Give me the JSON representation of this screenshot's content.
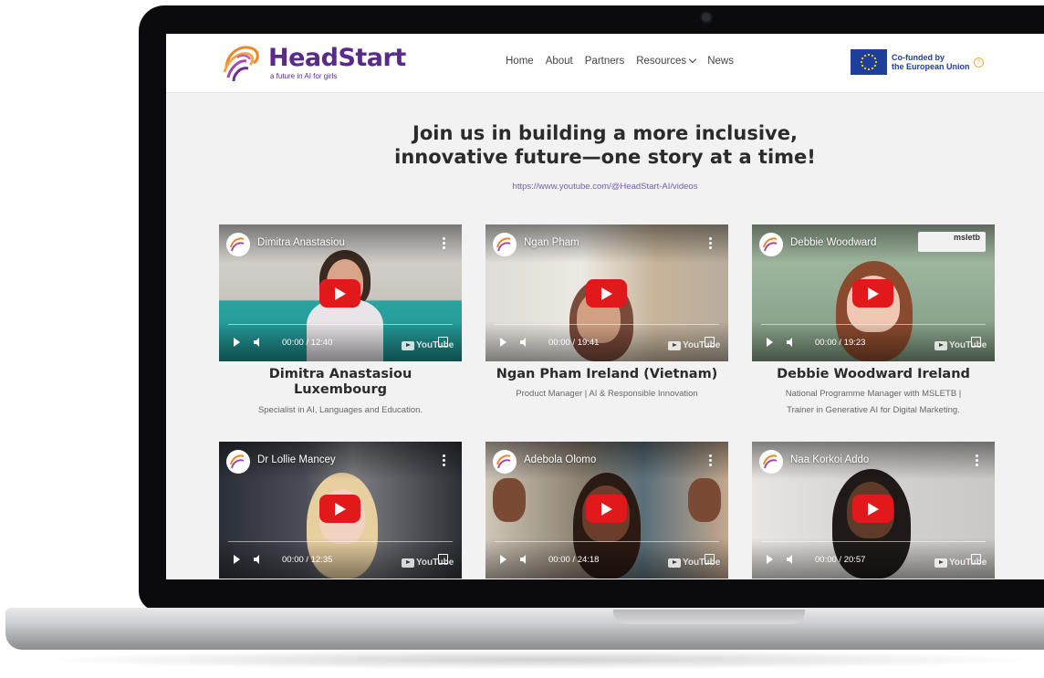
{
  "site": {
    "logo_name": "HeadStart",
    "logo_tagline": "a future in AI for girls",
    "nav": [
      {
        "label": "Home"
      },
      {
        "label": "About"
      },
      {
        "label": "Partners"
      },
      {
        "label": "Resources"
      },
      {
        "label": "News"
      }
    ],
    "eu_line1": "Co-funded by",
    "eu_line2": "the European Union"
  },
  "hero": {
    "title_line1": "Join us in building a more inclusive,",
    "title_line2": "innovative future—one story at a time!",
    "link": "https://www.youtube.com/@HeadStart-AI/videos"
  },
  "videos": [
    {
      "channel_name": "Dimitra Anastasiou",
      "time": "00:00 / 12:40",
      "title_line1": "Dimitra Anastasiou",
      "title_line2": "Luxembourg",
      "desc_line1": "Specialist in AI, Languages and Education.",
      "desc_line2": ""
    },
    {
      "channel_name": "Ngan Pham",
      "time": "00:00 / 19:41",
      "title_line1": "Ngan Pham Ireland (Vietnam)",
      "title_line2": "",
      "desc_line1": "Product Manager | AI & Responsible Innovation",
      "desc_line2": ""
    },
    {
      "channel_name": "Debbie Woodward",
      "time": "00:00 / 19:23",
      "title_line1": "Debbie Woodward Ireland",
      "title_line2": "",
      "desc_line1": "National Programme Manager with MSLETB |",
      "desc_line2": "Trainer in Generative AI for Digital Marketing.",
      "badge": "msletb"
    },
    {
      "channel_name": "Dr Lollie Mancey",
      "time": "00:00 / 12:35"
    },
    {
      "channel_name": "Adebola Olomo",
      "time": "00:00 / 24:18"
    },
    {
      "channel_name": "Naa Korkoi Addo",
      "time": "00:00 / 20:57"
    }
  ],
  "youtube_label": "YouTube",
  "colors": {
    "brand_purple": "#5a2a8a",
    "eu_blue": "#1e3f9c",
    "youtube_red": "#e1191b"
  }
}
